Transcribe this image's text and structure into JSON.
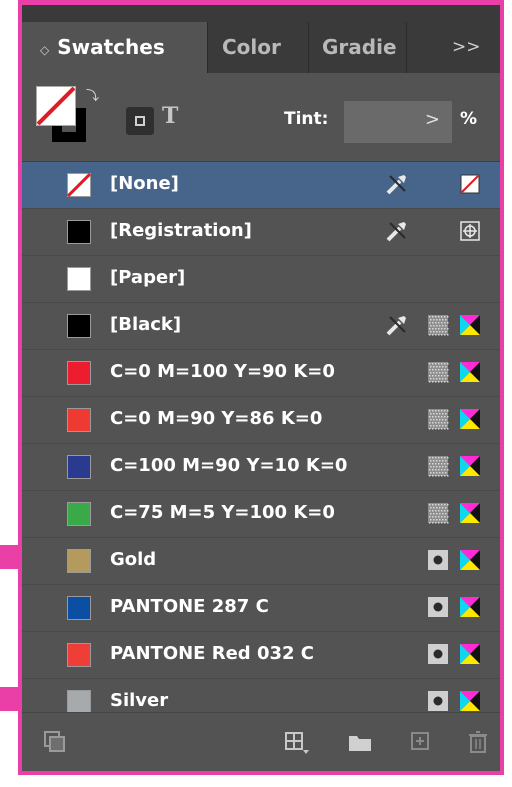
{
  "tabs": {
    "swatches_label": "Swatches",
    "color_label": "Color",
    "gradient_label": "Gradie",
    "overflow_label": ">>",
    "menu_label": "|≡",
    "updown_glyph": "◇"
  },
  "controls": {
    "text_glyph": "T",
    "tint_label": "Tint:",
    "tint_value": "",
    "tint_arrow": ">",
    "percent": "%"
  },
  "swatches": [
    {
      "name": "[None]",
      "chip": "none",
      "selected": true,
      "noedit": true,
      "type_icon": "",
      "mode_icon": "none"
    },
    {
      "name": "[Registration]",
      "chip": "#000000",
      "noedit": true,
      "type_icon": "",
      "mode_icon": "registration"
    },
    {
      "name": "[Paper]",
      "chip": "#ffffff",
      "noedit": false,
      "type_icon": "",
      "mode_icon": ""
    },
    {
      "name": "[Black]",
      "chip": "#000000",
      "noedit": true,
      "type_icon": "process",
      "mode_icon": "cmyk"
    },
    {
      "name": "C=0 M=100 Y=90 K=0",
      "chip": "#ed1c2e",
      "noedit": false,
      "type_icon": "process",
      "mode_icon": "cmyk"
    },
    {
      "name": "C=0 M=90 Y=86 K=0",
      "chip": "#ee3a33",
      "noedit": false,
      "type_icon": "process",
      "mode_icon": "cmyk"
    },
    {
      "name": "C=100 M=90 Y=10 K=0",
      "chip": "#2a3b8f",
      "noedit": false,
      "type_icon": "process",
      "mode_icon": "cmyk"
    },
    {
      "name": "C=75 M=5 Y=100 K=0",
      "chip": "#3aaa48",
      "noedit": false,
      "type_icon": "process",
      "mode_icon": "cmyk"
    },
    {
      "name": "Gold",
      "chip": "#b59a5e",
      "noedit": false,
      "type_icon": "spot",
      "mode_icon": "cmyk"
    },
    {
      "name": "PANTONE 287 C",
      "chip": "#0b4fa3",
      "noedit": false,
      "type_icon": "spot",
      "mode_icon": "cmyk"
    },
    {
      "name": "PANTONE Red 032 C",
      "chip": "#ef3d37",
      "noedit": false,
      "type_icon": "spot",
      "mode_icon": "cmyk"
    },
    {
      "name": "Silver",
      "chip": "#a7aaad",
      "noedit": false,
      "type_icon": "spot",
      "mode_icon": "cmyk"
    }
  ],
  "footer": {
    "icons": [
      "show-swatch-kinds-icon",
      "new-color-group-icon",
      "folder-icon",
      "new-swatch-icon",
      "delete-icon"
    ]
  },
  "colors": {
    "panel_bg": "#535353",
    "tabbar_bg": "#3a3a3a",
    "selection": "#47648a",
    "border_accent": "#ea3fa7"
  }
}
